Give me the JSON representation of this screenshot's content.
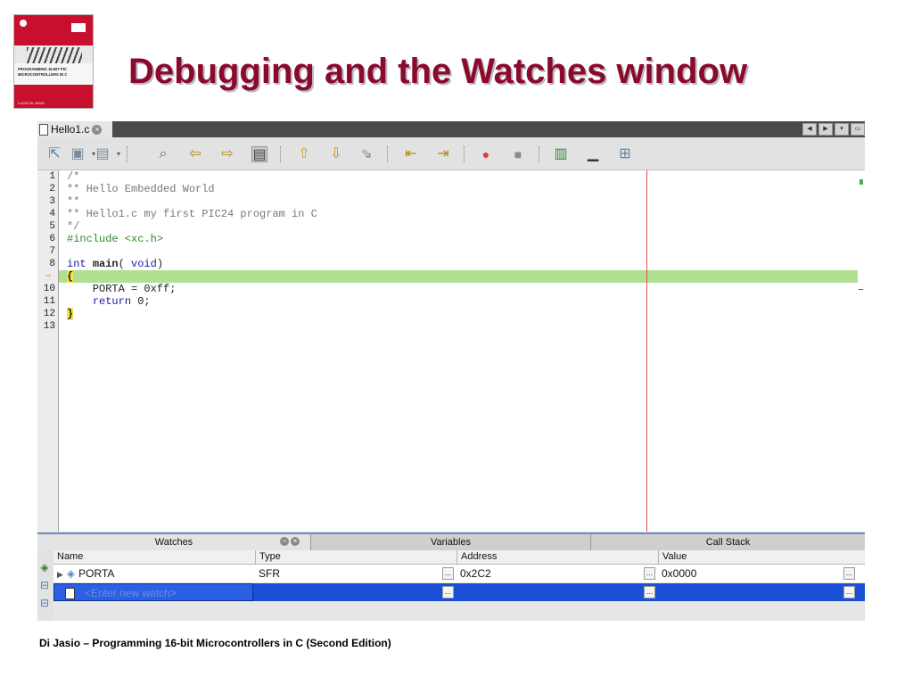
{
  "slide": {
    "title": "Debugging and the Watches window",
    "footer": "Di Jasio – Programming 16-bit Microcontrollers in C (Second Edition)"
  },
  "cover": {
    "title_line1": "PROGRAMMING 16-BIT PIC",
    "title_line2": "MICROCONTROLLERS IN C",
    "author": "LUCIO DI JASIO"
  },
  "editor": {
    "file_tab": "Hello1.c",
    "gutter_marker_icon": "current-line-arrow-icon",
    "lines": [
      {
        "no": "1",
        "text": "/*"
      },
      {
        "no": "2",
        "text": "** Hello Embedded World"
      },
      {
        "no": "3",
        "text": "**"
      },
      {
        "no": "4",
        "text": "** Hello1.c my first PIC24 program in C"
      },
      {
        "no": "5",
        "text": "*/"
      },
      {
        "no": "6",
        "text": "#include <xc.h>"
      },
      {
        "no": "7",
        "text": ""
      },
      {
        "no": "8",
        "kw": "int",
        "fn": "main",
        "pre": "(",
        "kw2": "void",
        "post": ")"
      },
      {
        "no": "",
        "text": "{"
      },
      {
        "no": "10",
        "text": "    PORTA = 0xff;"
      },
      {
        "no": "11",
        "kw": "return",
        "post": " 0;"
      },
      {
        "no": "12",
        "text": "}"
      },
      {
        "no": "13",
        "text": ""
      }
    ],
    "colors": {
      "current_line": "#b0e090",
      "margin_line": "#e05050",
      "brace_highlight": "#f5e642"
    }
  },
  "watches": {
    "tabs": [
      "Watches",
      "Variables",
      "Call Stack"
    ],
    "columns": [
      "Name",
      "Type",
      "Address",
      "Value"
    ],
    "rows": [
      {
        "name": "PORTA",
        "type": "SFR",
        "address": "0x2C2",
        "value": "0x0000"
      }
    ],
    "new_watch_placeholder": "<Enter new watch>",
    "ellipsis": "..."
  }
}
